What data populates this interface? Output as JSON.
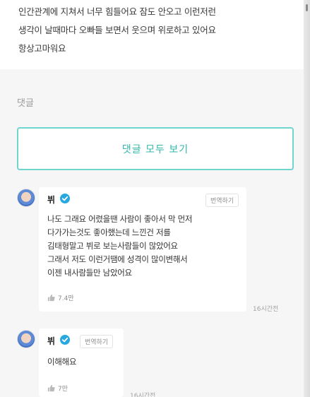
{
  "post": {
    "lines": [
      "인간관계에 지쳐서 너무 힘들어요 잠도 안오고 이런저런",
      "생각이 날때마다 오빠들 보면서 웃으며 위로하고 있어요",
      "항상고마워요"
    ]
  },
  "comments_section": {
    "title": "댓글",
    "view_all_label": "댓글 모두 보기"
  },
  "comments": [
    {
      "author": "뷔",
      "verified": true,
      "translate_label": "번역하기",
      "lines": [
        "나도 그래요 어렸을땐 사람이 좋아서 막 먼저",
        "다가가는것도 좋아했는데 느낀건 저를",
        "김태형말고 뷔로 보는사람들이 많았어요",
        "그래서 저도 이런거땜에 성격이 많이변해서",
        "이젠 내사람들만 남았어요"
      ],
      "likes": "7.4만",
      "time": "16시간전"
    },
    {
      "author": "뷔",
      "verified": true,
      "translate_label": "번역하기",
      "lines": [
        "이해해요"
      ],
      "likes": "7만",
      "time": "16시간전"
    }
  ],
  "colors": {
    "accent": "#33b7ac",
    "accent_border": "#6fd6cf",
    "verified": "#27a8de",
    "background": "#f6f6f7"
  },
  "icons": {
    "verified": "check-badge-icon",
    "like": "thumbs-up-icon"
  }
}
